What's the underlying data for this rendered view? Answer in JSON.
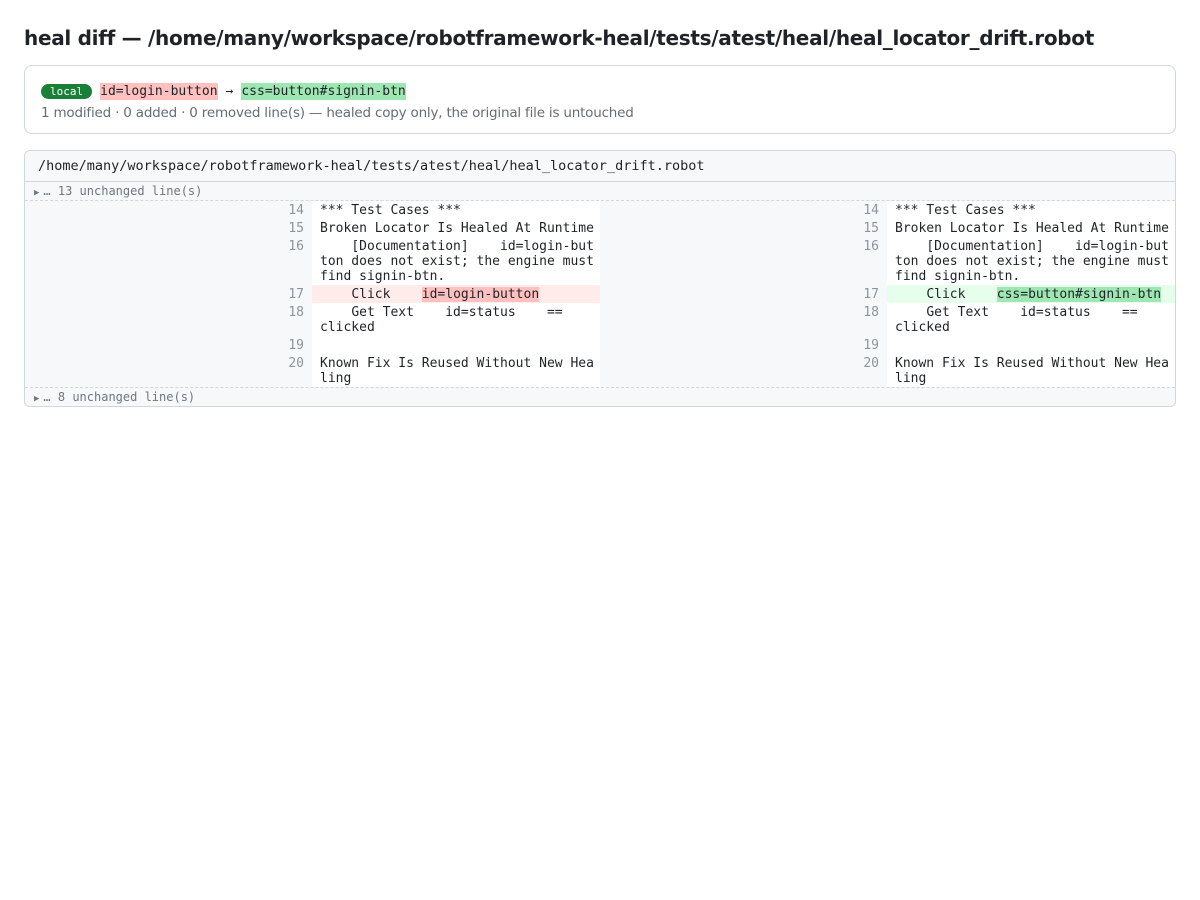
{
  "page": {
    "title": "heal diff — /home/many/workspace/robotframework-heal/tests/atest/heal/heal_locator_drift.robot"
  },
  "summary": {
    "badge": "local",
    "old_locator": "id=login-button",
    "arrow": "→",
    "new_locator": "css=button#signin-btn",
    "stats": "1 modified · 0 added · 0 removed line(s) — healed copy only, the original file is untouched"
  },
  "file": {
    "path": "/home/many/workspace/robotframework-heal/tests/atest/heal/heal_locator_drift.robot",
    "fold_top": "… 13 unchanged line(s)",
    "fold_bottom": "… 8 unchanged line(s)",
    "left": [
      {
        "num": "14",
        "text": "*** Test Cases ***"
      },
      {
        "num": "15",
        "text": "Broken Locator Is Healed At Runtime"
      },
      {
        "num": "16",
        "text": "    [Documentation]    id=login-button does not exist; the engine must find signin-btn."
      },
      {
        "num": "17",
        "pre": "    Click    ",
        "mark": "id=login-button"
      },
      {
        "num": "18",
        "text": "    Get Text    id=status    ==    clicked"
      },
      {
        "num": "19",
        "text": ""
      },
      {
        "num": "20",
        "text": "Known Fix Is Reused Without New Healing"
      }
    ],
    "right": [
      {
        "num": "14",
        "text": "*** Test Cases ***"
      },
      {
        "num": "15",
        "text": "Broken Locator Is Healed At Runtime"
      },
      {
        "num": "16",
        "text": "    [Documentation]    id=login-button does not exist; the engine must find signin-btn."
      },
      {
        "num": "17",
        "pre": "    Click    ",
        "mark": "css=button#signin-btn"
      },
      {
        "num": "18",
        "text": "    Get Text    id=status    ==    clicked"
      },
      {
        "num": "19",
        "text": ""
      },
      {
        "num": "20",
        "text": "Known Fix Is Reused Without New Healing"
      }
    ]
  },
  "colors": {
    "badge_bg": "#1a7f37",
    "removed_highlight": "#ffc1c0",
    "added_highlight": "#9ee7b2",
    "removed_line_bg": "#ffebe9",
    "added_line_bg": "#e6ffec"
  }
}
